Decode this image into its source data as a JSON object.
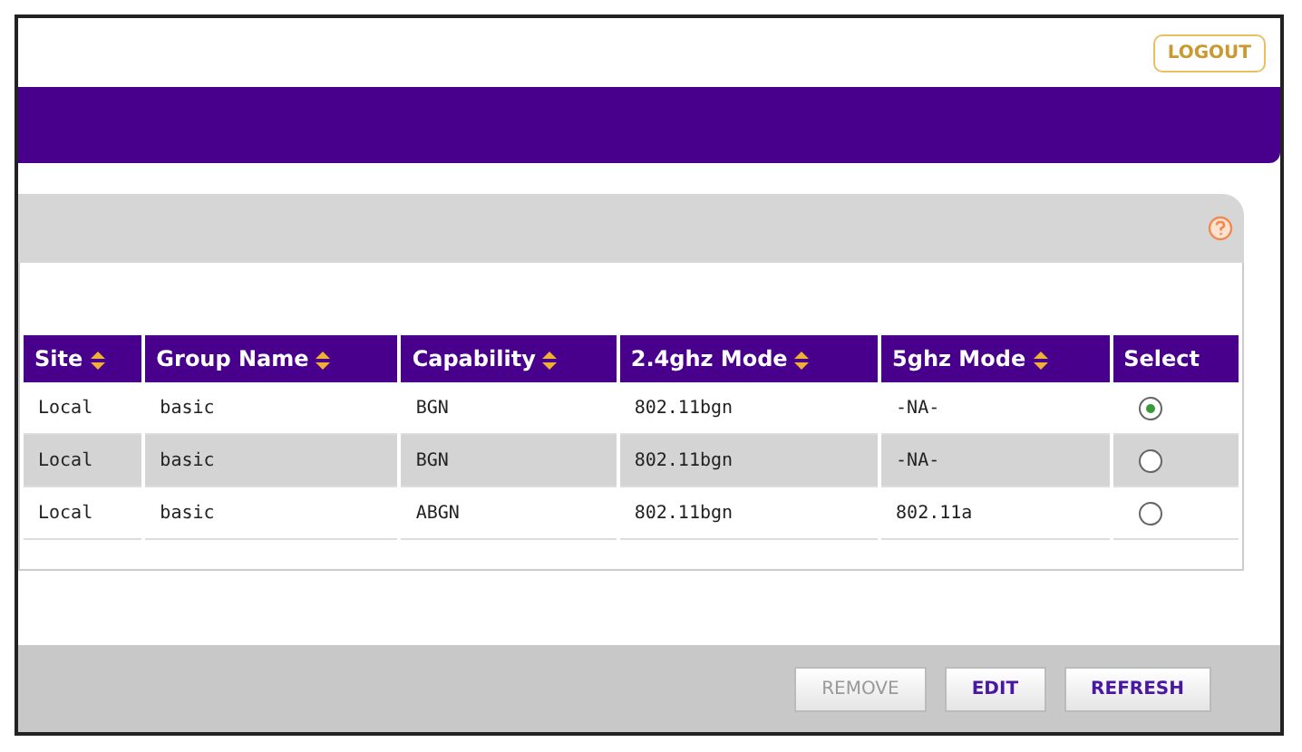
{
  "logout": {
    "label": "LOGOUT"
  },
  "table": {
    "columns": [
      {
        "label": "Site",
        "sortable": true
      },
      {
        "label": "Group Name",
        "sortable": true
      },
      {
        "label": "Capability",
        "sortable": true
      },
      {
        "label": "2.4ghz Mode",
        "sortable": true
      },
      {
        "label": "5ghz Mode",
        "sortable": true
      },
      {
        "label": "Select",
        "sortable": false
      }
    ],
    "rows": [
      {
        "cells": [
          "Local",
          "basic",
          "BGN",
          "802.11bgn",
          "-NA-"
        ],
        "selected": true
      },
      {
        "cells": [
          "Local",
          "basic",
          "BGN",
          "802.11bgn",
          "-NA-"
        ],
        "selected": false
      },
      {
        "cells": [
          "Local",
          "basic",
          "ABGN",
          "802.11bgn",
          "802.11a"
        ],
        "selected": false
      }
    ]
  },
  "buttons": [
    {
      "label": "REMOVE",
      "disabled": true
    },
    {
      "label": "EDIT",
      "disabled": false
    },
    {
      "label": "REFRESH",
      "disabled": false
    }
  ]
}
